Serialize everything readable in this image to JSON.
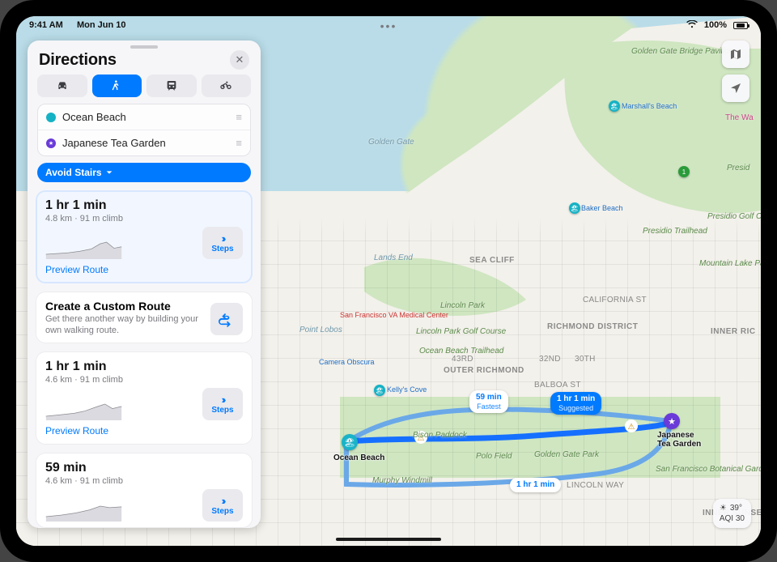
{
  "status_bar": {
    "time": "9:41 AM",
    "date": "Mon Jun 10",
    "battery_pct": "100%"
  },
  "sidebar": {
    "title": "Directions",
    "modes": {
      "car": "Drive",
      "walk": "Walk",
      "transit": "Transit",
      "bike": "Cycle",
      "active": "walk"
    },
    "stops": {
      "from": "Ocean Beach",
      "to": "Japanese Tea Garden"
    },
    "avoid_pill": "Avoid Stairs",
    "routes": [
      {
        "time": "1 hr 1 min",
        "detail": "4.8 km · 91 m climb",
        "preview": "Preview Route",
        "steps_label": "Steps"
      },
      {
        "time": "1 hr 1 min",
        "detail": "4.6 km · 91 m climb",
        "preview": "Preview Route",
        "steps_label": "Steps"
      },
      {
        "time": "59 min",
        "detail": "4.6 km · 91 m climb",
        "preview": "",
        "steps_label": "Steps"
      }
    ],
    "custom": {
      "title": "Create a Custom Route",
      "subtitle": "Get there another way by building your own walking route."
    }
  },
  "route_callouts": {
    "suggested_time": "1 hr 1 min",
    "suggested_label": "Suggested",
    "fastest_time": "59 min",
    "fastest_label": "Fastest",
    "alt_time": "1 hr 1 min"
  },
  "endpoints": {
    "start": "Ocean Beach",
    "end_line1": "Japanese",
    "end_line2": "Tea Garden"
  },
  "map_labels": {
    "golden_gate": "Golden Gate",
    "golden_gate_bp": "Golden Gate Bridge Pavilion",
    "marshalls_beach": "Marshall's Beach",
    "the_wa": "The Wa",
    "presid": "Presid",
    "baker_beach": "Baker Beach",
    "presidio_trailhead": "Presidio Trailhead",
    "lands_end": "Lands End",
    "sea_cliff": "SEA CLIFF",
    "mountain_lake_park": "Mountain Lake Park",
    "presidio_golf": "Presidio Golf C",
    "california_st": "CALIFORNIA ST",
    "point_lobos": "Point Lobos",
    "sf_va": "San Francisco VA Medical Center",
    "lincoln_park": "Lincoln Park",
    "lincoln_park_gc": "Lincoln Park Golf Course",
    "richmond": "RICHMOND DISTRICT",
    "inner_ric": "INNER RIC",
    "camera_obscura": "Camera Obscura",
    "ocean_beach_th": "Ocean Beach Trailhead",
    "kellys_cove": "Kelly's Cove",
    "outer_richmond": "OUTER RICHMOND",
    "px_43rd": "43RD",
    "px_32nd": "32ND",
    "px_30th": "30TH",
    "balboa": "BALBOA ST",
    "bison": "Bison Paddock",
    "polo": "Polo Field",
    "ggp": "Golden Gate Park",
    "sfbg": "San Francisco Botanical Garden",
    "murphy": "Murphy Windmill",
    "lincoln_way": "LINCOLN WAY",
    "inner_sunset": "INNER SUNSET"
  },
  "weather": {
    "temp": "39°",
    "aqi": "AQI 30"
  },
  "colors": {
    "accent": "#007aff",
    "route_alt": "#6aa8e8",
    "route_main": "#1670ff",
    "pin_start": "#15b2c5",
    "pin_end": "#6a3bd8"
  }
}
